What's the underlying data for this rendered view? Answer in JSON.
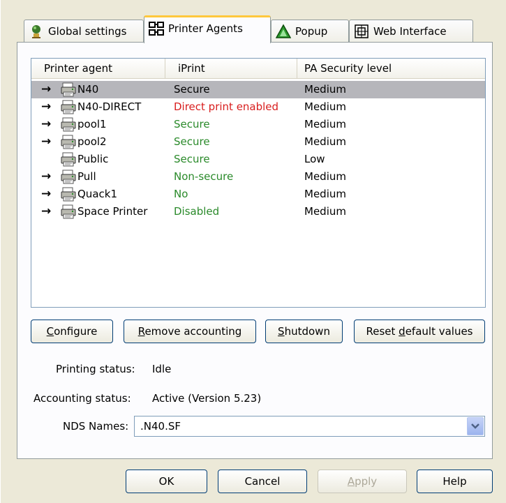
{
  "tabs": [
    {
      "label": "Global settings",
      "icon": "globe-person-icon",
      "active": false
    },
    {
      "label": "Printer Agents",
      "icon": "printer-agents-icon",
      "active": true
    },
    {
      "label": "Popup",
      "icon": "triangle-icon",
      "active": false
    },
    {
      "label": "Web Interface",
      "icon": "web-interface-icon",
      "active": false
    }
  ],
  "list": {
    "headers": [
      "Printer agent",
      "iPrint",
      "PA Security level"
    ],
    "rows": [
      {
        "arrow": "→",
        "name": "N40",
        "status": "Secure",
        "status_color": "default",
        "level": "Medium",
        "selected": true
      },
      {
        "arrow": "→",
        "name": "N40-DIRECT",
        "status": "Direct print enabled",
        "status_color": "red",
        "level": "Medium"
      },
      {
        "arrow": "→",
        "name": "pool1",
        "status": "Secure",
        "status_color": "green",
        "level": "Medium"
      },
      {
        "arrow": "→",
        "name": "pool2",
        "status": "Secure",
        "status_color": "green",
        "level": "Medium"
      },
      {
        "arrow": "",
        "name": "Public",
        "status": "Secure",
        "status_color": "green",
        "level": "Low"
      },
      {
        "arrow": "→",
        "name": "Pull",
        "status": "Non-secure",
        "status_color": "green",
        "level": "Medium"
      },
      {
        "arrow": "→",
        "name": "Quack1",
        "status": "No",
        "status_color": "green",
        "level": "Medium"
      },
      {
        "arrow": "→",
        "name": "Space Printer",
        "status": "Disabled",
        "status_color": "green",
        "level": "Medium"
      }
    ]
  },
  "actions": {
    "configure": {
      "mn": "C",
      "rest": "onfigure"
    },
    "remove_accounting": {
      "mn": "R",
      "rest": "emove accounting"
    },
    "shutdown": {
      "mn": "S",
      "rest": "hutdown"
    },
    "reset": {
      "pre": "Reset ",
      "mn": "d",
      "rest": "efault values"
    }
  },
  "status": {
    "printing_label": "Printing status:",
    "printing_value": "Idle",
    "accounting_label": "Accounting status:",
    "accounting_value": "Active (Version 5.23)",
    "nds_label": "NDS Names:",
    "nds_value": ".N40.SF"
  },
  "dialog_buttons": {
    "ok": "OK",
    "cancel": "Cancel",
    "apply": {
      "mn": "A",
      "rest": "pply"
    },
    "help": "Help"
  },
  "colors": {
    "red": "#d81e1e",
    "green": "#2a8a2a",
    "selected": "#b6b6bb",
    "tab_highlight": "#ffc83c"
  }
}
